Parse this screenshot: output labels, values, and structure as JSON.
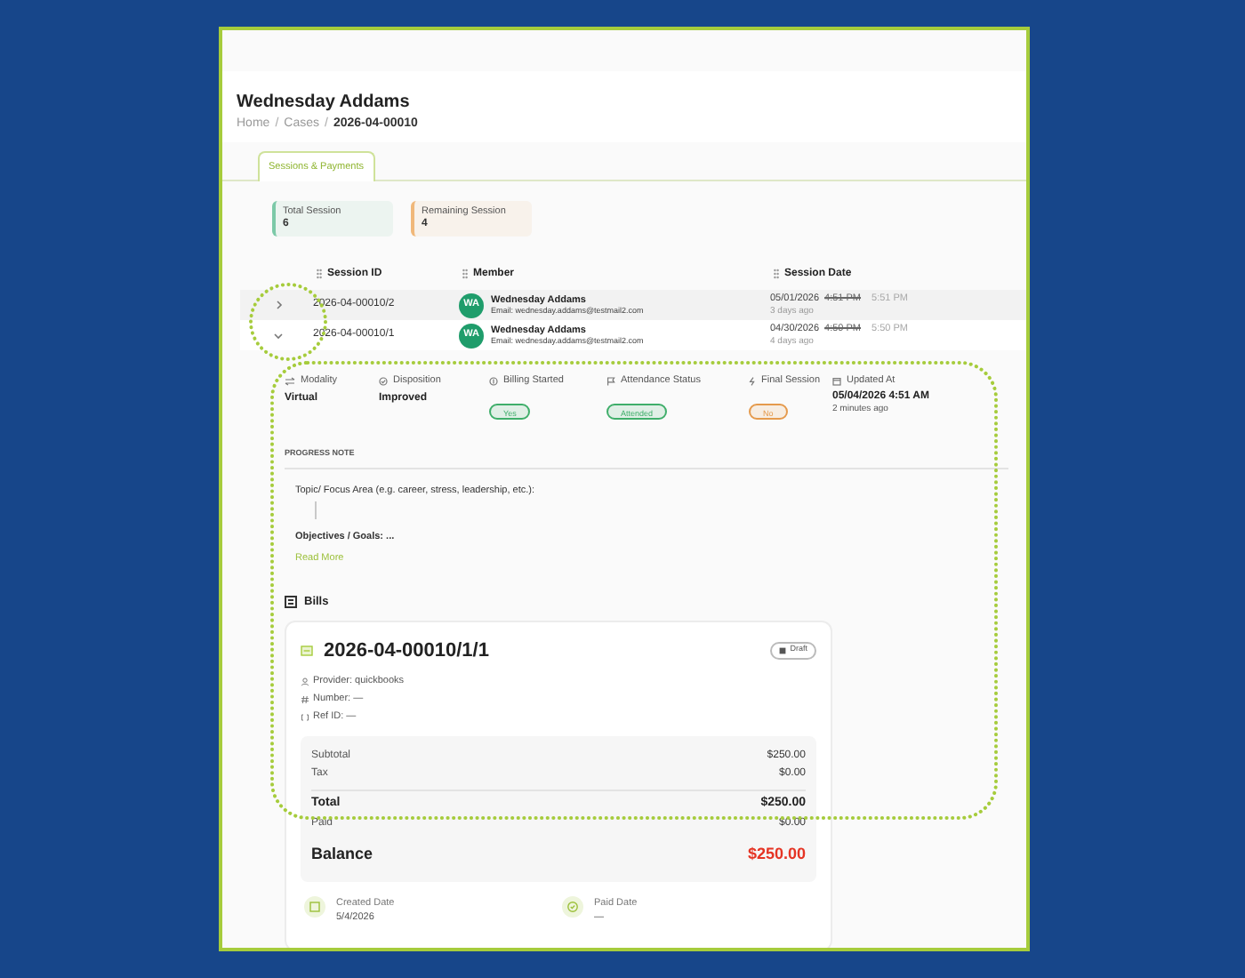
{
  "page": {
    "title": "Wednesday Addams",
    "breadcrumb": [
      "Home",
      "Cases",
      "2026-04-00010"
    ],
    "separator": "/"
  },
  "tabs": [
    {
      "label": "Sessions & Payments",
      "selected": true
    }
  ],
  "stats": [
    {
      "label": "Total Session",
      "value": "6",
      "color": "#7cc9a8"
    },
    {
      "label": "Remaining Session",
      "value": "4",
      "color": "#f0b87a"
    }
  ],
  "table": {
    "columns": [
      "Session ID",
      "Member",
      "Session Date"
    ],
    "rows": [
      {
        "expanded": false,
        "session_id": "2026-04-00010/2",
        "avatar": "WA",
        "member_name": "Wednesday Addams",
        "member_email": "Email: wednesday.addams@testmail2.com",
        "date": "05/01/2026",
        "start_time": "4:51 PM",
        "end_time": "5:51 PM",
        "relative": "3 days ago"
      },
      {
        "expanded": true,
        "session_id": "2026-04-00010/1",
        "avatar": "WA",
        "member_name": "Wednesday Addams",
        "member_email": "Email: wednesday.addams@testmail2.com",
        "date": "04/30/2026",
        "start_time": "4:50 PM",
        "end_time": "5:50 PM",
        "relative": "4 days ago"
      }
    ]
  },
  "session_details": {
    "fields": [
      {
        "kind": "text",
        "label": "Modality",
        "value": "Virtual"
      },
      {
        "kind": "text",
        "label": "Disposition",
        "value": "Improved"
      },
      {
        "kind": "badge",
        "label": "Billing Started",
        "value": "Yes",
        "color": "#3fae6a"
      },
      {
        "kind": "badge",
        "label": "Attendance Status",
        "value": "Attended",
        "color": "#3fae6a"
      },
      {
        "kind": "badge",
        "label": "Final Session",
        "value": "No",
        "color": "#e59a4c"
      },
      {
        "kind": "date",
        "label": "Updated At",
        "value": "05/04/2026 4:51 AM",
        "sub": "2 minutes ago"
      }
    ],
    "progress_note": {
      "heading": "PROGRESS NOTE",
      "topic": "Topic/ Focus Area (e.g. career, stress, leadership, etc.):",
      "objectives": "Objectives / Goals: ...",
      "read_more": "Read More"
    }
  },
  "bills": {
    "heading": "Bills",
    "items": [
      {
        "number": "2026-04-00010/1/1",
        "status": "Draft",
        "meta": [
          "Provider: quickbooks",
          "Number: —",
          "Ref ID: —"
        ],
        "lines": [
          {
            "kind": "line",
            "label": "Subtotal",
            "amount": "$250.00"
          },
          {
            "kind": "line",
            "label": "Tax",
            "amount": "$0.00"
          },
          {
            "kind": "total",
            "label": "Total",
            "amount": "$250.00"
          },
          {
            "kind": "line",
            "label": "Paid",
            "amount": "$0.00"
          },
          {
            "kind": "balance",
            "label": "Balance",
            "amount": "$250.00"
          }
        ],
        "dates": [
          {
            "label": "Created Date",
            "value": "5/4/2026"
          },
          {
            "label": "Paid Date",
            "value": "—"
          }
        ]
      }
    ]
  }
}
